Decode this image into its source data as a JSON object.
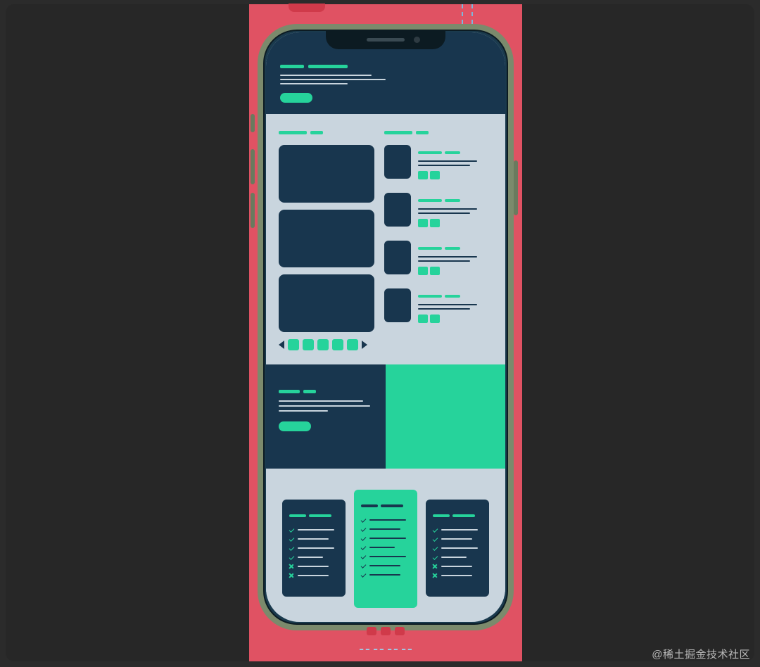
{
  "diagram": {
    "description": "Illustration of a mobile phone mockup showing a zoomed-out wireframe landing page inside an iPhone-style frame, placed on a dark canvas with a red column backdrop and alignment guides.",
    "backdrop": {
      "color": "#e05263",
      "has_top_tab": true,
      "top_guides": 2,
      "bottom_pager_dots": 3,
      "bottom_dash_segments": 4
    },
    "phone": {
      "frame_color": "#7b8a6c",
      "side_buttons": [
        "mute",
        "volume-up",
        "volume-down",
        "power"
      ],
      "notch": true
    },
    "colors": {
      "dark": "#18364e",
      "light": "#c9d5de",
      "teal": "#26d39b"
    },
    "sections": {
      "hero": {
        "title_bars": 2,
        "body_lines": 3,
        "cta": true
      },
      "gallery": {
        "left": {
          "title_bars": 2,
          "large_cards": 3,
          "pager_dots": 5,
          "arrows": true
        },
        "right": {
          "title_bars": 2,
          "items": 4,
          "item": {
            "title_bars": 2,
            "body_lines": 2,
            "chips": 2
          }
        }
      },
      "split_banner": {
        "left": {
          "title_bars": 2,
          "body_lines": 3,
          "cta": true
        },
        "right_fill": "teal"
      },
      "pricing": {
        "plans": [
          {
            "variant": "dark",
            "features": [
              "check",
              "check",
              "check",
              "check",
              "cross",
              "cross"
            ]
          },
          {
            "variant": "teal",
            "features": [
              "check",
              "check",
              "check",
              "check",
              "check",
              "check",
              "check"
            ]
          },
          {
            "variant": "dark",
            "features": [
              "check",
              "check",
              "check",
              "check",
              "cross",
              "cross"
            ]
          }
        ]
      }
    }
  },
  "watermark": "@稀土掘金技术社区"
}
